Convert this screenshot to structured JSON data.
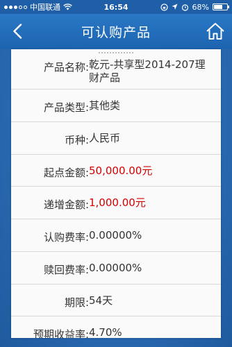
{
  "status_bar": {
    "carrier": "中国联通",
    "time": "16:54",
    "battery": "68%",
    "battery_level": 0.68
  },
  "nav": {
    "title": "可认购产品",
    "back_icon": "chevron-left-icon",
    "home_icon": "home-icon"
  },
  "product": {
    "rows": [
      {
        "label": "产品名称:",
        "value": "乾元-共享型2014-207理财产品",
        "highlight": false
      },
      {
        "label": "产品类型:",
        "value": "其他类",
        "highlight": false
      },
      {
        "label": "币种:",
        "value": "人民币",
        "highlight": false
      },
      {
        "label": "起点金额:",
        "value": "50,000.00元",
        "highlight": true
      },
      {
        "label": "递增金额:",
        "value": "1,000.00元",
        "highlight": true
      },
      {
        "label": "认购费率:",
        "value": "0.00000%",
        "highlight": false
      },
      {
        "label": "赎回费率:",
        "value": "0.00000%",
        "highlight": false
      },
      {
        "label": "期限:",
        "value": "54天",
        "highlight": false
      },
      {
        "label": "预期收益率:",
        "value": "4.70%",
        "highlight": false
      }
    ]
  },
  "colors": {
    "nav_bg": "#1c64b0",
    "highlight": "#d40000"
  }
}
